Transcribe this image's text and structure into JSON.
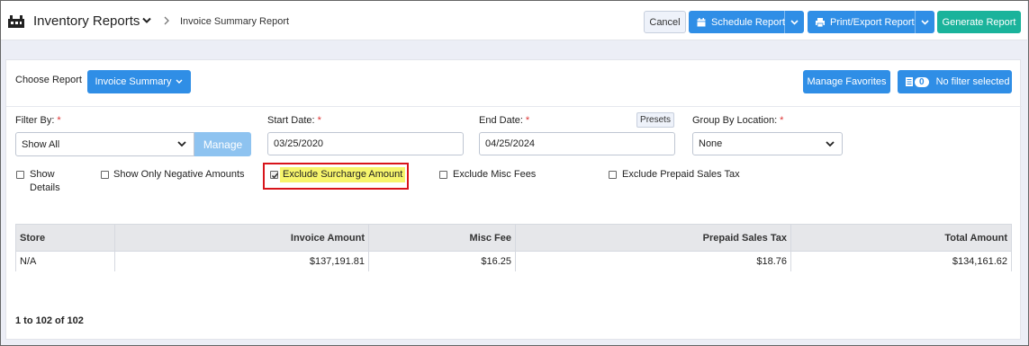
{
  "header": {
    "app_title": "Inventory Reports",
    "breadcrumb": "Invoice Summary Report",
    "cancel_label": "Cancel",
    "schedule_label": "Schedule Report",
    "print_label": "Print/Export Report",
    "generate_label": "Generate Report"
  },
  "toolbar": {
    "choose_report_label": "Choose Report",
    "report_select": "Invoice Summary",
    "manage_favorites_label": "Manage Favorites",
    "filter_count": "0",
    "filter_status": "No filter selected"
  },
  "filters": {
    "filter_by_label": "Filter By:",
    "filter_by_value": "Show All",
    "manage_label": "Manage",
    "start_date_label": "Start Date:",
    "start_date_value": "03/25/2020",
    "end_date_label": "End Date:",
    "end_date_value": "04/25/2024",
    "presets_label": "Presets",
    "group_by_label": "Group By Location:",
    "group_by_value": "None",
    "required_mark": "*"
  },
  "options": {
    "show_details_line1": "Show",
    "show_details_line2": "Details",
    "show_negative": "Show Only Negative Amounts",
    "exclude_surcharge": "Exclude Surcharge Amount",
    "exclude_misc": "Exclude Misc Fees",
    "exclude_prepaid": "Exclude Prepaid Sales Tax"
  },
  "table": {
    "columns": [
      "Store",
      "Invoice Amount",
      "Misc Fee",
      "Prepaid Sales Tax",
      "Total Amount"
    ],
    "rows": [
      [
        "N/A",
        "$137,191.81",
        "$16.25",
        "$18.76",
        "$134,161.62"
      ]
    ]
  },
  "pagination": "1 to 102 of 102",
  "colors": {
    "primary": "#2f8ee6",
    "teal": "#1ab39b",
    "highlight_border": "#d8141b",
    "highlight_fill": "#f7f56c"
  }
}
